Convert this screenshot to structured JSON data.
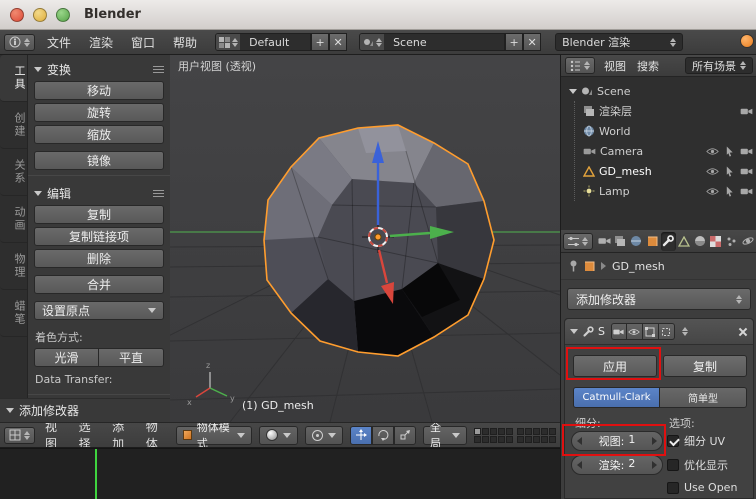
{
  "window": {
    "title": "Blender"
  },
  "topbar": {
    "menus": [
      "文件",
      "渲染",
      "窗口",
      "帮助"
    ],
    "layout": {
      "value": "Default"
    },
    "scene": {
      "value": "Scene"
    },
    "engine": {
      "value": "Blender 渲染"
    },
    "add_glyph": "+",
    "close_glyph": "✕"
  },
  "tool_tabs": {
    "items": [
      "工具",
      "创建",
      "关系",
      "动画",
      "物理",
      "蜡笔"
    ],
    "active": "工具"
  },
  "tool_shelf": {
    "transform": {
      "title": "变换",
      "buttons": [
        "移动",
        "旋转",
        "缩放",
        "镜像"
      ]
    },
    "edit": {
      "title": "编辑",
      "buttons": [
        "复制",
        "复制链接项",
        "删除",
        "合并"
      ],
      "origin_button": "设置原点",
      "shading_label": "着色方式:",
      "smooth": "光滑",
      "flat": "平直",
      "data_transfer": "Data Transfer:"
    },
    "add_modifier_title": "添加修改器"
  },
  "viewport": {
    "view_label": "用户视图 (透视)",
    "object_label": "(1) GD_mesh",
    "axis": {
      "x": "x",
      "y": "y",
      "z": "z"
    },
    "colors": {
      "selection_outline": "#ff9d2e",
      "axis_x": "#d9463c",
      "axis_y": "#4cb04c",
      "axis_z": "#3a62d9"
    }
  },
  "viewport_header": {
    "menus": [
      "视图",
      "选择",
      "添加",
      "物体"
    ],
    "mode": "物体模式",
    "orientation": "全局"
  },
  "timeline": {
    "playhead_color": "#3fd43f"
  },
  "outliner": {
    "menu_view": "视图",
    "menu_search": "搜索",
    "display_filter": "所有场景",
    "items": [
      {
        "label": "Scene"
      },
      {
        "label": "渲染层"
      },
      {
        "label": "World"
      },
      {
        "label": "Camera"
      },
      {
        "label": "GD_mesh"
      },
      {
        "label": "Lamp"
      }
    ]
  },
  "properties": {
    "breadcrumb": {
      "object": "GD_mesh"
    },
    "add_modifier_button": "添加修改器",
    "modifier": {
      "name": "S",
      "apply": "应用",
      "copy": "复制",
      "type_catmull": "Catmull-Clark",
      "type_simple": "简单型",
      "subdivisions_label": "细分:",
      "options_label": "选项:",
      "view_label": "视图:",
      "view_value": "1",
      "render_label": "渲染:",
      "render_value": "2",
      "opt_uv": "细分 UV",
      "opt_optimal": "优化显示",
      "opt_opensubdiv": "Use Open"
    }
  },
  "annotations": {
    "color": "#e01010"
  }
}
